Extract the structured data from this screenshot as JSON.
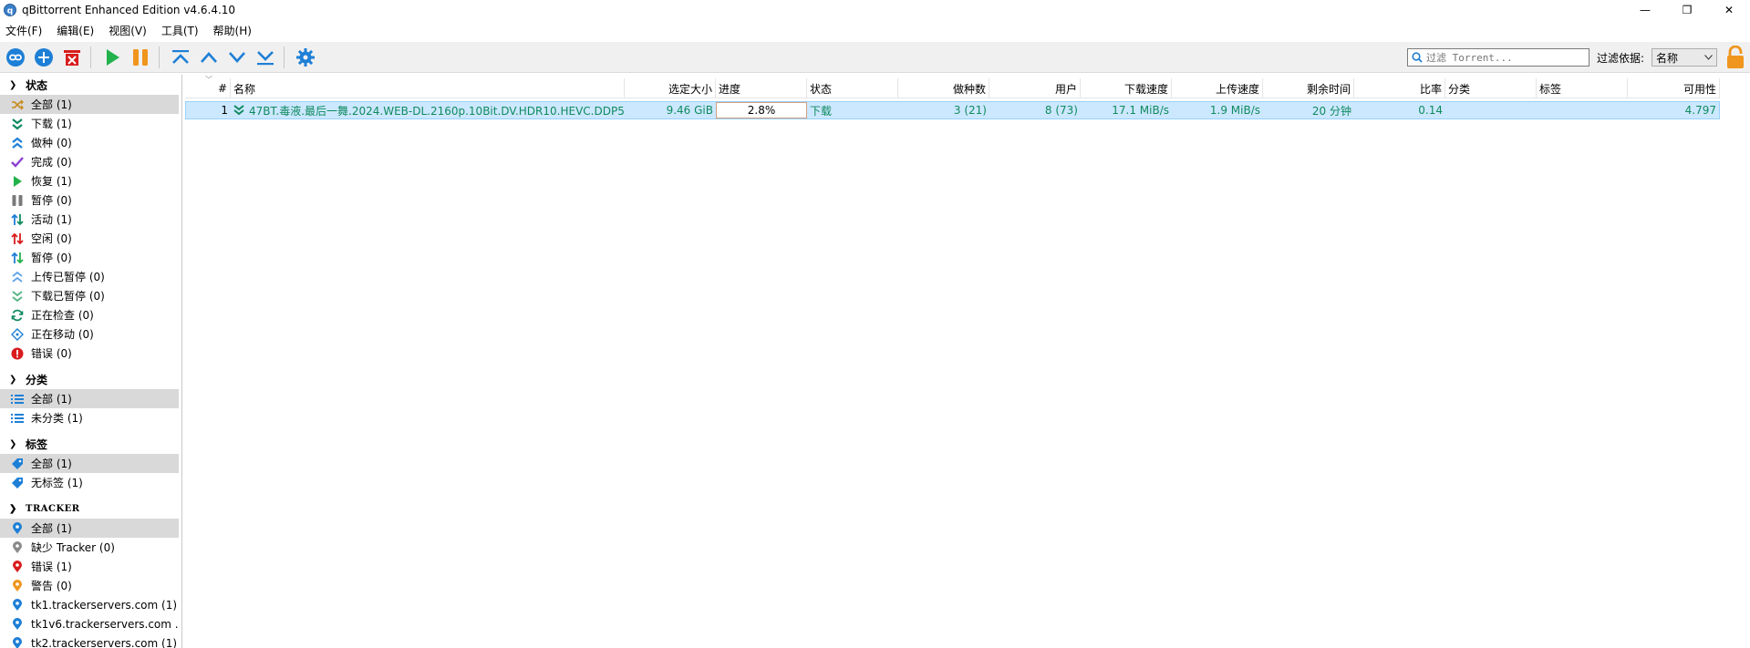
{
  "window": {
    "title": "qBittorrent Enhanced Edition v4.6.4.10",
    "minimize": "—",
    "maximize": "❐",
    "close": "✕"
  },
  "menu": [
    "文件(F)",
    "编辑(E)",
    "视图(V)",
    "工具(T)",
    "帮助(H)"
  ],
  "toolbar": {
    "search_placeholder": "过滤 Torrent...",
    "filter_label": "过滤依据:",
    "filter_value": "名称"
  },
  "sidebar": {
    "status": {
      "header": "状态",
      "items": [
        {
          "label": "全部 (1)",
          "icon": "shuffle-icon"
        },
        {
          "label": "下载 (1)",
          "icon": "download-arrows-icon"
        },
        {
          "label": "做种 (0)",
          "icon": "seeding-arrows-icon"
        },
        {
          "label": "完成 (0)",
          "icon": "check-icon"
        },
        {
          "label": "恢复 (1)",
          "icon": "play-icon"
        },
        {
          "label": "暂停 (0)",
          "icon": "pause-icon"
        },
        {
          "label": "活动 (1)",
          "icon": "active-arrows-icon"
        },
        {
          "label": "空闲 (0)",
          "icon": "inactive-arrows-icon"
        },
        {
          "label": "暂停 (0)",
          "icon": "stalled-arrows-icon"
        },
        {
          "label": "上传已暂停 (0)",
          "icon": "upload-stalled-icon"
        },
        {
          "label": "下载已暂停 (0)",
          "icon": "download-stalled-icon"
        },
        {
          "label": "正在检查 (0)",
          "icon": "refresh-icon"
        },
        {
          "label": "正在移动 (0)",
          "icon": "move-icon"
        },
        {
          "label": "错误 (0)",
          "icon": "error-icon"
        }
      ]
    },
    "categories": {
      "header": "分类",
      "items": [
        {
          "label": "全部 (1)",
          "icon": "list-icon"
        },
        {
          "label": "未分类 (1)",
          "icon": "list-icon"
        }
      ]
    },
    "tags": {
      "header": "标签",
      "items": [
        {
          "label": "全部 (1)",
          "icon": "tag-icon"
        },
        {
          "label": "无标签 (1)",
          "icon": "tag-icon"
        }
      ]
    },
    "trackers": {
      "header": "TRACKER",
      "items": [
        {
          "label": "全部 (1)",
          "icon": "pin-icon"
        },
        {
          "label": "缺少 Tracker (0)",
          "icon": "pin-gray-icon"
        },
        {
          "label": "错误 (1)",
          "icon": "pin-red-icon"
        },
        {
          "label": "警告 (0)",
          "icon": "pin-orange-icon"
        },
        {
          "label": "tk1.trackerservers.com (1)",
          "icon": "pin-icon"
        },
        {
          "label": "tk1v6.trackerservers.com ...",
          "icon": "pin-icon"
        },
        {
          "label": "tk2.trackerservers.com (1)",
          "icon": "pin-icon"
        }
      ]
    }
  },
  "table": {
    "columns": [
      "#",
      "名称",
      "选定大小",
      "进度",
      "状态",
      "做种数",
      "用户",
      "下载速度",
      "上传速度",
      "剩余时间",
      "比率",
      "分类",
      "标签",
      "可用性"
    ],
    "rows": [
      {
        "num": "1",
        "name": "47BT.毒液.最后一舞.2024.WEB-DL.2160p.10Bit.DV.HDR10.HEVC.DDP5...",
        "size": "9.46 GiB",
        "progress": "2.8%",
        "status": "下载",
        "seeds": "3 (21)",
        "peers": "8 (73)",
        "dl_speed": "17.1 MiB/s",
        "ul_speed": "1.9 MiB/s",
        "eta": "20 分钟",
        "ratio": "0.14",
        "category": "",
        "tags": "",
        "availability": "4.797"
      }
    ]
  },
  "colors": {
    "download_green": "#0f8a5f",
    "selection": "#cce8ff",
    "toolbar_blue": "#1e7fd6"
  }
}
